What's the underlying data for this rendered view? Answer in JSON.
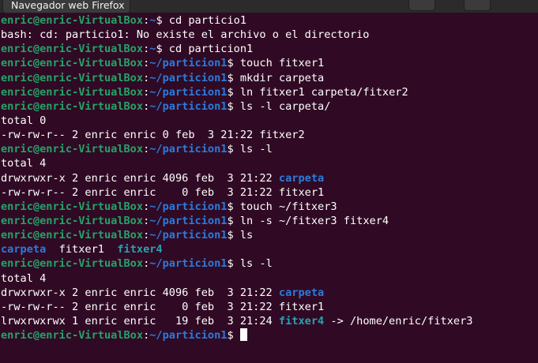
{
  "window": {
    "tooltip": "Navegador web Firefox"
  },
  "colors": {
    "background": "#300a24",
    "prompt_user": "#26a269",
    "prompt_path": "#2a7bde",
    "directory": "#2a7bde",
    "symlink": "#2aa1b3",
    "text": "#ffffff"
  },
  "terminal": {
    "lines": [
      [
        {
          "t": "enric@enric-VirtualBox",
          "c": "user"
        },
        {
          "t": ":",
          "c": "txt"
        },
        {
          "t": "~",
          "c": "path"
        },
        {
          "t": "$ cd particio1",
          "c": "txt"
        }
      ],
      [
        {
          "t": "bash: cd: particio1: No existe el archivo o el directorio",
          "c": "txt"
        }
      ],
      [
        {
          "t": "enric@enric-VirtualBox",
          "c": "user"
        },
        {
          "t": ":",
          "c": "txt"
        },
        {
          "t": "~",
          "c": "path"
        },
        {
          "t": "$ cd particion1",
          "c": "txt"
        }
      ],
      [
        {
          "t": "enric@enric-VirtualBox",
          "c": "user"
        },
        {
          "t": ":",
          "c": "txt"
        },
        {
          "t": "~/particion1",
          "c": "path"
        },
        {
          "t": "$ touch fitxer1",
          "c": "txt"
        }
      ],
      [
        {
          "t": "enric@enric-VirtualBox",
          "c": "user"
        },
        {
          "t": ":",
          "c": "txt"
        },
        {
          "t": "~/particion1",
          "c": "path"
        },
        {
          "t": "$ mkdir carpeta",
          "c": "txt"
        }
      ],
      [
        {
          "t": "enric@enric-VirtualBox",
          "c": "user"
        },
        {
          "t": ":",
          "c": "txt"
        },
        {
          "t": "~/particion1",
          "c": "path"
        },
        {
          "t": "$ ln fitxer1 carpeta/fitxer2",
          "c": "txt"
        }
      ],
      [
        {
          "t": "enric@enric-VirtualBox",
          "c": "user"
        },
        {
          "t": ":",
          "c": "txt"
        },
        {
          "t": "~/particion1",
          "c": "path"
        },
        {
          "t": "$ ls -l carpeta/",
          "c": "txt"
        }
      ],
      [
        {
          "t": "total 0",
          "c": "txt"
        }
      ],
      [
        {
          "t": "-rw-rw-r-- 2 enric enric 0 feb  3 21:22 fitxer2",
          "c": "txt"
        }
      ],
      [
        {
          "t": "enric@enric-VirtualBox",
          "c": "user"
        },
        {
          "t": ":",
          "c": "txt"
        },
        {
          "t": "~/particion1",
          "c": "path"
        },
        {
          "t": "$ ls -l",
          "c": "txt"
        }
      ],
      [
        {
          "t": "total 4",
          "c": "txt"
        }
      ],
      [
        {
          "t": "drwxrwxr-x 2 enric enric 4096 feb  3 21:22 ",
          "c": "txt"
        },
        {
          "t": "carpeta",
          "c": "dir"
        }
      ],
      [
        {
          "t": "-rw-rw-r-- 2 enric enric    0 feb  3 21:22 fitxer1",
          "c": "txt"
        }
      ],
      [
        {
          "t": "enric@enric-VirtualBox",
          "c": "user"
        },
        {
          "t": ":",
          "c": "txt"
        },
        {
          "t": "~/particion1",
          "c": "path"
        },
        {
          "t": "$ touch ~/fitxer3",
          "c": "txt"
        }
      ],
      [
        {
          "t": "enric@enric-VirtualBox",
          "c": "user"
        },
        {
          "t": ":",
          "c": "txt"
        },
        {
          "t": "~/particion1",
          "c": "path"
        },
        {
          "t": "$ ln -s ~/fitxer3 fitxer4",
          "c": "txt"
        }
      ],
      [
        {
          "t": "enric@enric-VirtualBox",
          "c": "user"
        },
        {
          "t": ":",
          "c": "txt"
        },
        {
          "t": "~/particion1",
          "c": "path"
        },
        {
          "t": "$ ls",
          "c": "txt"
        }
      ],
      [
        {
          "t": "carpeta",
          "c": "dir"
        },
        {
          "t": "  fitxer1  ",
          "c": "txt"
        },
        {
          "t": "fitxer4",
          "c": "link"
        }
      ],
      [
        {
          "t": "enric@enric-VirtualBox",
          "c": "user"
        },
        {
          "t": ":",
          "c": "txt"
        },
        {
          "t": "~/particion1",
          "c": "path"
        },
        {
          "t": "$ ls -l",
          "c": "txt"
        }
      ],
      [
        {
          "t": "total 4",
          "c": "txt"
        }
      ],
      [
        {
          "t": "drwxrwxr-x 2 enric enric 4096 feb  3 21:22 ",
          "c": "txt"
        },
        {
          "t": "carpeta",
          "c": "dir"
        }
      ],
      [
        {
          "t": "-rw-rw-r-- 2 enric enric    0 feb  3 21:22 fitxer1",
          "c": "txt"
        }
      ],
      [
        {
          "t": "lrwxrwxrwx 1 enric enric   19 feb  3 21:24 ",
          "c": "txt"
        },
        {
          "t": "fitxer4",
          "c": "link"
        },
        {
          "t": " -> /home/enric/fitxer3",
          "c": "txt"
        }
      ],
      [
        {
          "t": "enric@enric-VirtualBox",
          "c": "user"
        },
        {
          "t": ":",
          "c": "txt"
        },
        {
          "t": "~/particion1",
          "c": "path"
        },
        {
          "t": "$ ",
          "c": "txt"
        }
      ]
    ]
  }
}
